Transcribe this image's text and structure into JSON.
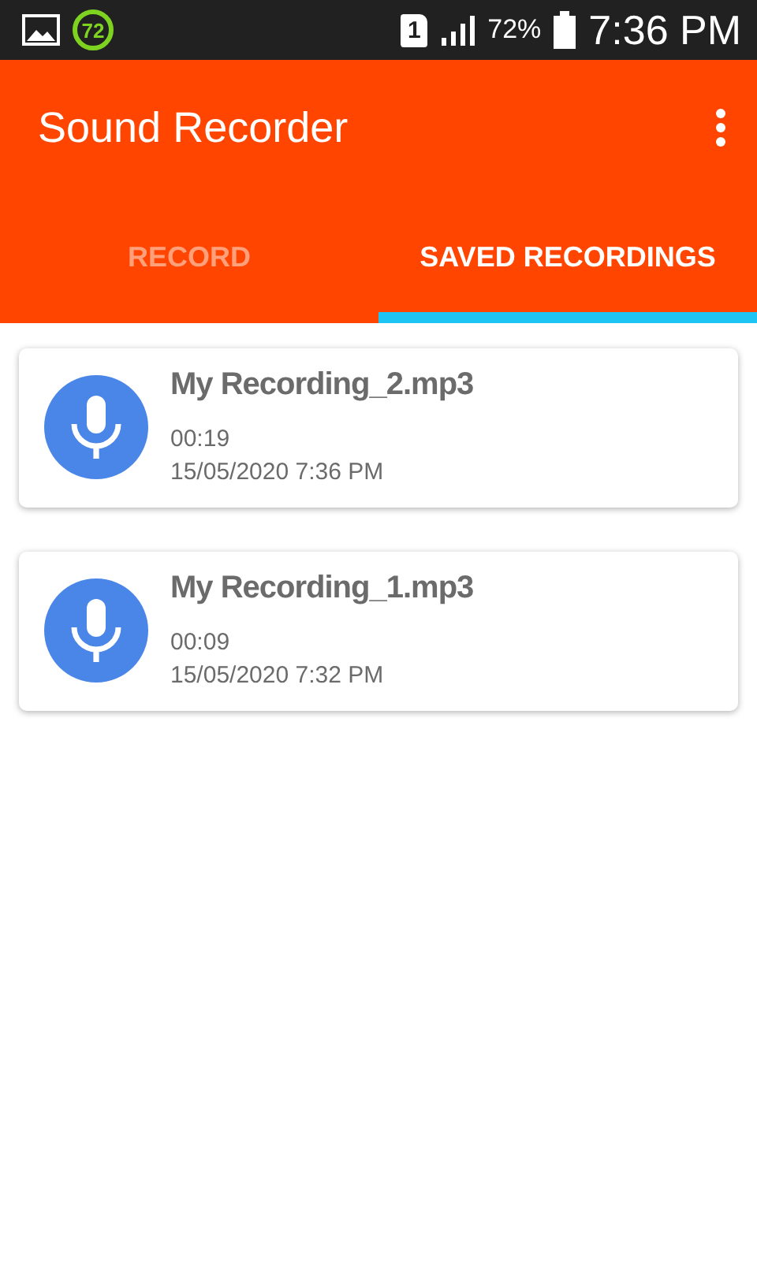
{
  "status_bar": {
    "badge": "72",
    "sim": "1",
    "battery": "72%",
    "time": "7:36 PM"
  },
  "app_bar": {
    "title": "Sound Recorder"
  },
  "tabs": [
    {
      "label": "RECORD",
      "selected": false
    },
    {
      "label": "SAVED RECORDINGS",
      "selected": true
    }
  ],
  "recordings": [
    {
      "name": "My Recording_2.mp3",
      "duration": "00:19",
      "date": "15/05/2020 7:36 PM"
    },
    {
      "name": "My Recording_1.mp3",
      "duration": "00:09",
      "date": "15/05/2020 7:32 PM"
    }
  ]
}
